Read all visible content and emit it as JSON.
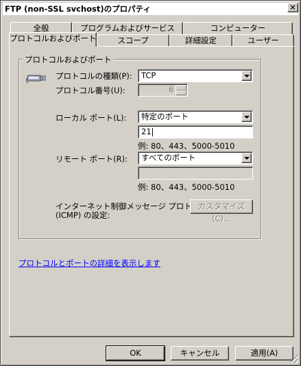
{
  "window": {
    "title": "FTP (non-SSL svchost)のプロパティ",
    "close_glyph": "✕"
  },
  "tabs": {
    "row1": [
      "全般",
      "プログラムおよびサービス",
      "コンピューター"
    ],
    "row2": [
      "プロトコルおよびポート",
      "スコープ",
      "詳細設定",
      "ユーザー"
    ],
    "active": "プロトコルおよびポート"
  },
  "group": {
    "legend": "プロトコルおよびポート",
    "icon": "network-cable-icon",
    "protocol_type_label": "プロトコルの種類(P):",
    "protocol_type_value": "TCP",
    "protocol_number_label": "プロトコル番号(U):",
    "protocol_number_value": "6",
    "local_port_label": "ローカル ポート(L):",
    "local_port_mode": "特定のポート",
    "local_port_value": "21",
    "local_port_hint": "例: 80、443、5000-5010",
    "remote_port_label": "リモート ポート(R):",
    "remote_port_mode": "すべてのポート",
    "remote_port_value": "",
    "remote_port_hint": "例: 80、443、5000-5010",
    "icmp_label_line1": "インターネット制御メッセージ プロトコル",
    "icmp_label_line2": "(ICMP) の設定:",
    "customize_button": "カスタマイズ(C)..."
  },
  "link": {
    "text": "プロトコルとポートの詳細を表示します"
  },
  "footer": {
    "ok": "OK",
    "cancel": "キャンセル",
    "apply": "適用(A)"
  }
}
